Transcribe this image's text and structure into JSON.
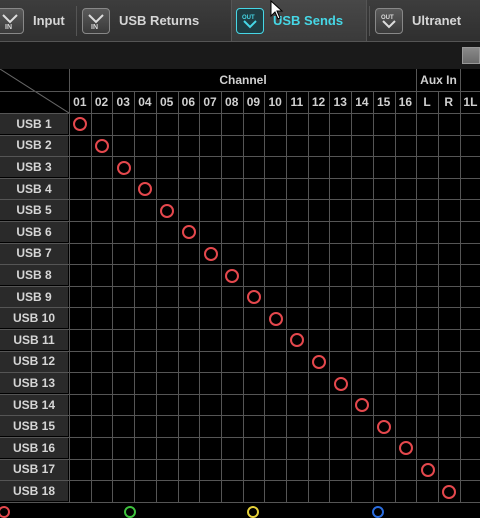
{
  "tabs": [
    {
      "label": "Input",
      "icon": "input-icon",
      "active": false
    },
    {
      "label": "USB Returns",
      "icon": "usb-returns-icon",
      "active": false
    },
    {
      "label": "USB Sends",
      "icon": "usb-sends-icon",
      "active": true
    },
    {
      "label": "Ultranet",
      "icon": "ultranet-icon",
      "active": false
    }
  ],
  "matrix": {
    "group_headers": [
      "Channel",
      "Aux In"
    ],
    "columns": [
      "01",
      "02",
      "03",
      "04",
      "05",
      "06",
      "07",
      "08",
      "09",
      "10",
      "11",
      "12",
      "13",
      "14",
      "15",
      "16",
      "L",
      "R",
      "1L"
    ],
    "rows": [
      "USB 1",
      "USB 2",
      "USB 3",
      "USB 4",
      "USB 5",
      "USB 6",
      "USB 7",
      "USB 8",
      "USB 9",
      "USB 10",
      "USB 11",
      "USB 12",
      "USB 13",
      "USB 14",
      "USB 15",
      "USB 16",
      "USB 17",
      "USB 18"
    ],
    "routes": [
      {
        "row": "USB 1",
        "col": "01"
      },
      {
        "row": "USB 2",
        "col": "02"
      },
      {
        "row": "USB 3",
        "col": "03"
      },
      {
        "row": "USB 4",
        "col": "04"
      },
      {
        "row": "USB 5",
        "col": "05"
      },
      {
        "row": "USB 6",
        "col": "06"
      },
      {
        "row": "USB 7",
        "col": "07"
      },
      {
        "row": "USB 8",
        "col": "08"
      },
      {
        "row": "USB 9",
        "col": "09"
      },
      {
        "row": "USB 10",
        "col": "10"
      },
      {
        "row": "USB 11",
        "col": "11"
      },
      {
        "row": "USB 12",
        "col": "12"
      },
      {
        "row": "USB 13",
        "col": "13"
      },
      {
        "row": "USB 14",
        "col": "14"
      },
      {
        "row": "USB 15",
        "col": "15"
      },
      {
        "row": "USB 16",
        "col": "16"
      },
      {
        "row": "USB 17",
        "col": "L"
      },
      {
        "row": "USB 18",
        "col": "R"
      }
    ],
    "route_color": "#e5484d"
  },
  "legend_colors": [
    "#e5484d",
    "#3ec43e",
    "#e6d13a",
    "#2a6de0"
  ]
}
